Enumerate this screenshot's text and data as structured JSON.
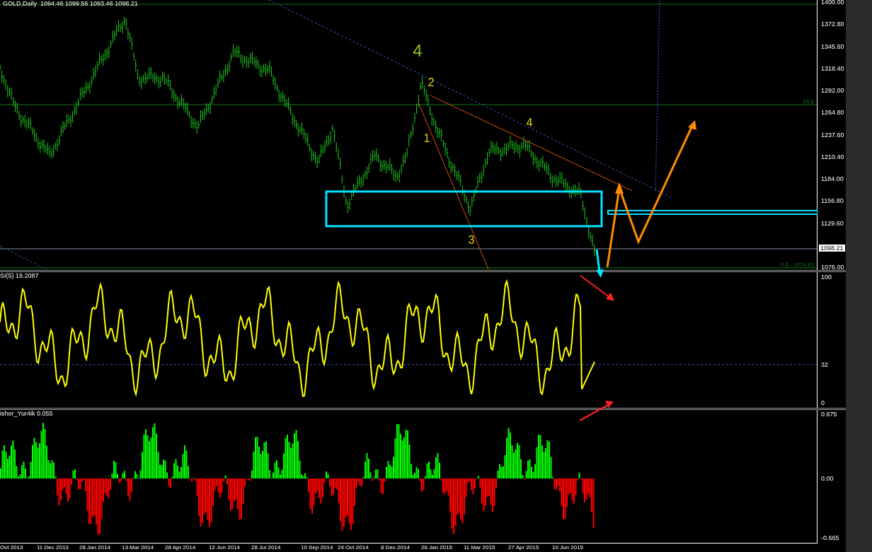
{
  "header": {
    "symbol": "GOLD,Daily",
    "ohlc": "1094.46 1099.56 1093.46 1098.21"
  },
  "main_panel": {
    "price_ticks": [
      "1400.00",
      "1372.80",
      "1345.60",
      "1318.40",
      "1292.00",
      "1264.80",
      "1237.60",
      "1210.40",
      "1184.00",
      "1156.80",
      "1129.60",
      "1076.00"
    ],
    "price_label": "1098.21",
    "fib_levels": [
      {
        "label": "23.6"
      },
      {
        "label": "0.0 - 1074.83"
      }
    ],
    "wave_labels": [
      {
        "text": "4",
        "kind": "major"
      },
      {
        "text": "2",
        "kind": "minor"
      },
      {
        "text": "1",
        "kind": "minor"
      },
      {
        "text": "4",
        "kind": "minor"
      },
      {
        "text": "3",
        "kind": "minor"
      }
    ]
  },
  "rsi_panel": {
    "title": "SI(5) 19.2087",
    "ticks": [
      "100",
      "32",
      "0"
    ]
  },
  "fisher_panel": {
    "title": "isher_Yur4ik 0.055",
    "ticks": [
      "0.675",
      "0.00",
      "-0.665"
    ]
  },
  "date_axis": [
    "Oct 2013",
    "11 Dec 2013",
    "28 Jan 2014",
    "13 Mar 2014",
    "28 Apr 2014",
    "12 Jun 2014",
    "28 Jul 2014",
    "10 Sep 2014",
    "24 Oct 2014",
    "8 Dec 2014",
    "26 Jan 2015",
    "11 Mar 2015",
    "27 Apr 2015",
    "10 Jun 2015"
  ]
}
